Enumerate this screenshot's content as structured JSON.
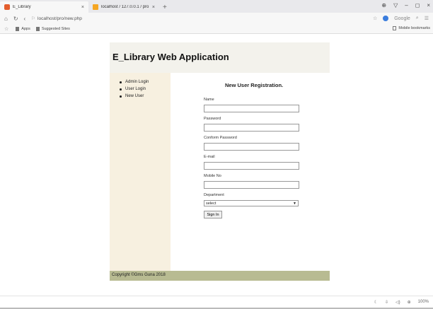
{
  "browser": {
    "tabs": [
      {
        "title": "E_Library",
        "close": "×"
      },
      {
        "title": "localhost / 127.0.0.1 / pro / stu",
        "close": "×"
      }
    ],
    "new_tab": "+",
    "window_controls": [
      "⊕",
      "▽",
      "–",
      "◻",
      "×"
    ],
    "address": "localhost/pro/new.php",
    "search_engine": "Google",
    "bookmarks": [
      "Apps",
      "Suggested Sites"
    ],
    "mobile_bookmarks": "Mobile bookmarks",
    "zoom": "100%"
  },
  "page": {
    "header": "E_Library Web Application",
    "sidebar": [
      "Admin Login",
      "User Login",
      "New User"
    ],
    "form": {
      "title": "New User Registration.",
      "fields": [
        "Name",
        "Password",
        "Conform Password",
        "E-mail",
        "Mobile No"
      ],
      "department_label": "Department",
      "department_selected": "select",
      "submit": "Sign In"
    },
    "footer": "Copyright ©Gms Guna 2018"
  },
  "colors": {
    "header_bg": "#f3f2ec",
    "sidebar_bg": "#f7f0e0",
    "footer_bg": "#b8bb92"
  }
}
